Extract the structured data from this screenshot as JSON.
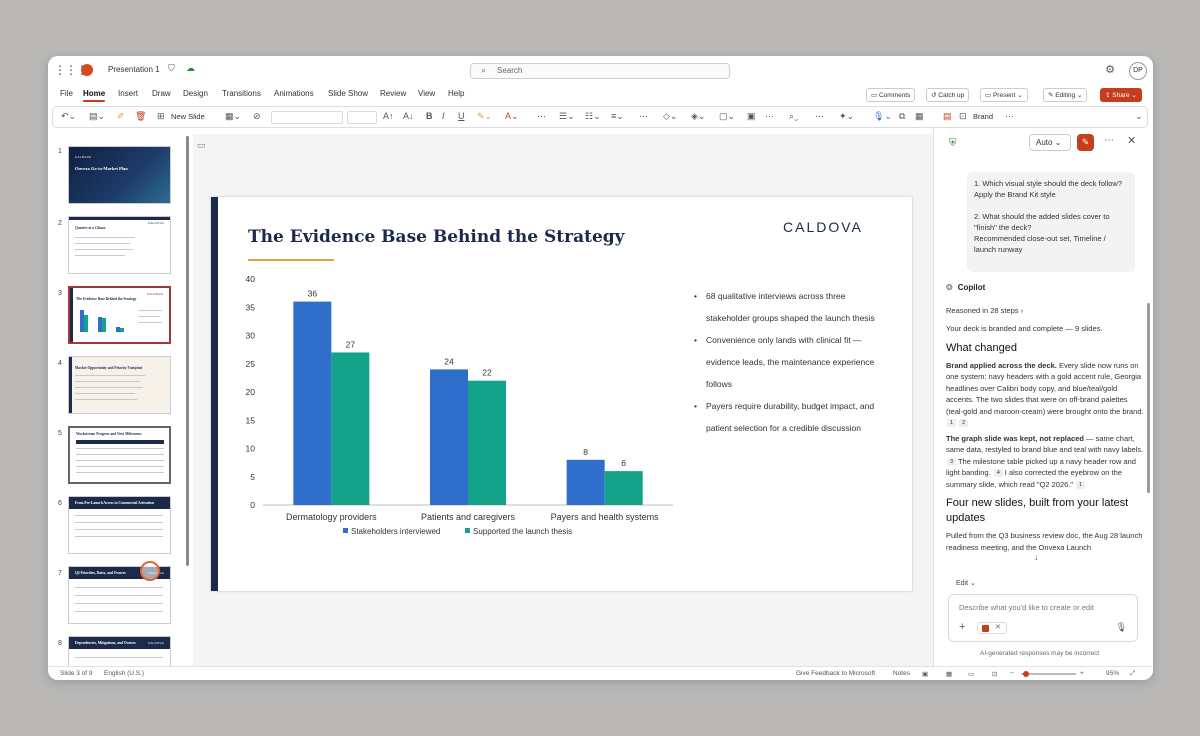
{
  "app": {
    "title": "Presentation 1",
    "search_placeholder": "Search",
    "avatar": "DP"
  },
  "menu": [
    "File",
    "Home",
    "Insert",
    "Draw",
    "Design",
    "Transitions",
    "Animations",
    "Slide Show",
    "Review",
    "View",
    "Help"
  ],
  "menu_active": "Home",
  "menu_buttons": {
    "comments": "Comments",
    "catchup": "Catch up",
    "present": "Present",
    "editing": "Editing",
    "share": "Share"
  },
  "ribbon": {
    "new_slide": "New Slide",
    "brand": "Brand"
  },
  "thumbnails": [
    {
      "n": "1",
      "title": "Onvexa Go-to-Market Plan",
      "brand": "CALDOVA"
    },
    {
      "n": "2",
      "title": "Quarter at a Glance",
      "brand": "CALDOVA"
    },
    {
      "n": "3",
      "title": "The Evidence Base Behind the Strategy",
      "brand": "CALDOVA"
    },
    {
      "n": "4",
      "title": "Market Opportunity and Priority Footprint",
      "brand": ""
    },
    {
      "n": "5",
      "title": "Workstream Progress and Next Milestones",
      "brand": ""
    },
    {
      "n": "6",
      "title": "From Pre-Launch Access to Commercial Activation",
      "brand": "CALDOVA"
    },
    {
      "n": "7",
      "title": "Q4 Priorities, Dates, and Owners",
      "brand": "CALDOVA"
    },
    {
      "n": "8",
      "title": "Dependencies, Mitigations, and Owners",
      "brand": "CALDOVA"
    }
  ],
  "slide": {
    "title": "The Evidence Base Behind the Strategy",
    "logo": "CALDOVA",
    "bullets": [
      "68 qualitative interviews across three stakeholder groups shaped the launch thesis",
      "Convenience only lands with clinical fit — evidence leads, the maintenance experience follows",
      "Payers require durability, budget impact, and patient selection for a credible discussion"
    ]
  },
  "chart_data": {
    "type": "bar",
    "categories": [
      "Dermatology providers",
      "Patients and caregivers",
      "Payers and health systems"
    ],
    "series": [
      {
        "name": "Stakeholders interviewed",
        "values": [
          36,
          24,
          8
        ],
        "color": "#2f6ecb"
      },
      {
        "name": "Supported the launch thesis",
        "values": [
          27,
          22,
          6
        ],
        "color": "#14a38a"
      }
    ],
    "ylim": [
      0,
      40
    ],
    "yticks": [
      0,
      5,
      10,
      15,
      20,
      25,
      30,
      35,
      40
    ],
    "legend": "bottom",
    "grid": false
  },
  "status": {
    "slide": "Slide 3 of 9",
    "lang": "English (U.S.)",
    "feedback": "Give Feedback to Microsoft",
    "notes": "Notes",
    "zoom": "95%"
  },
  "copilot": {
    "auto": "Auto",
    "user_q1": "1. Which visual style should the deck follow?",
    "user_a1": "Apply the Brand Kit style",
    "user_q2": "2. What should the added slides cover to \"finish\" the deck?",
    "user_a2": "Recommended close-out set, Timeline / launch runway",
    "name": "Copilot",
    "reasoned": "Reasoned in 28 steps",
    "intro": "Your deck is branded and complete — 9 slides.",
    "h1": "What changed",
    "p1_bold": "Brand applied across the deck.",
    "p1": " Every slide now runs on one system: navy headers with a gold accent rule, Georgia headlines over Calibri body copy, and blue/teal/gold accents. The two slides that were on off-brand palettes (teal-gold and maroon-cream) were brought onto the brand.",
    "p2_bold": "The graph slide was kept, not replaced",
    "p2": " — same chart, same data, restyled to brand blue and teal with navy labels.",
    "p2b": " The milestone table picked up a navy header row and light banding.",
    "p2c": " I also corrected the eyebrow on the summary slide, which read \"Q2 2026.\"",
    "h2": "Four new slides, built from your latest updates",
    "p3": "Pulled from the Q3 business review doc, the Aug 28 launch readiness meeting, and the Onvexa Launch",
    "edit": "Edit",
    "placeholder": "Describe what you'd like to create or edit",
    "disclaimer": "AI-generated responses may be incorrect"
  }
}
